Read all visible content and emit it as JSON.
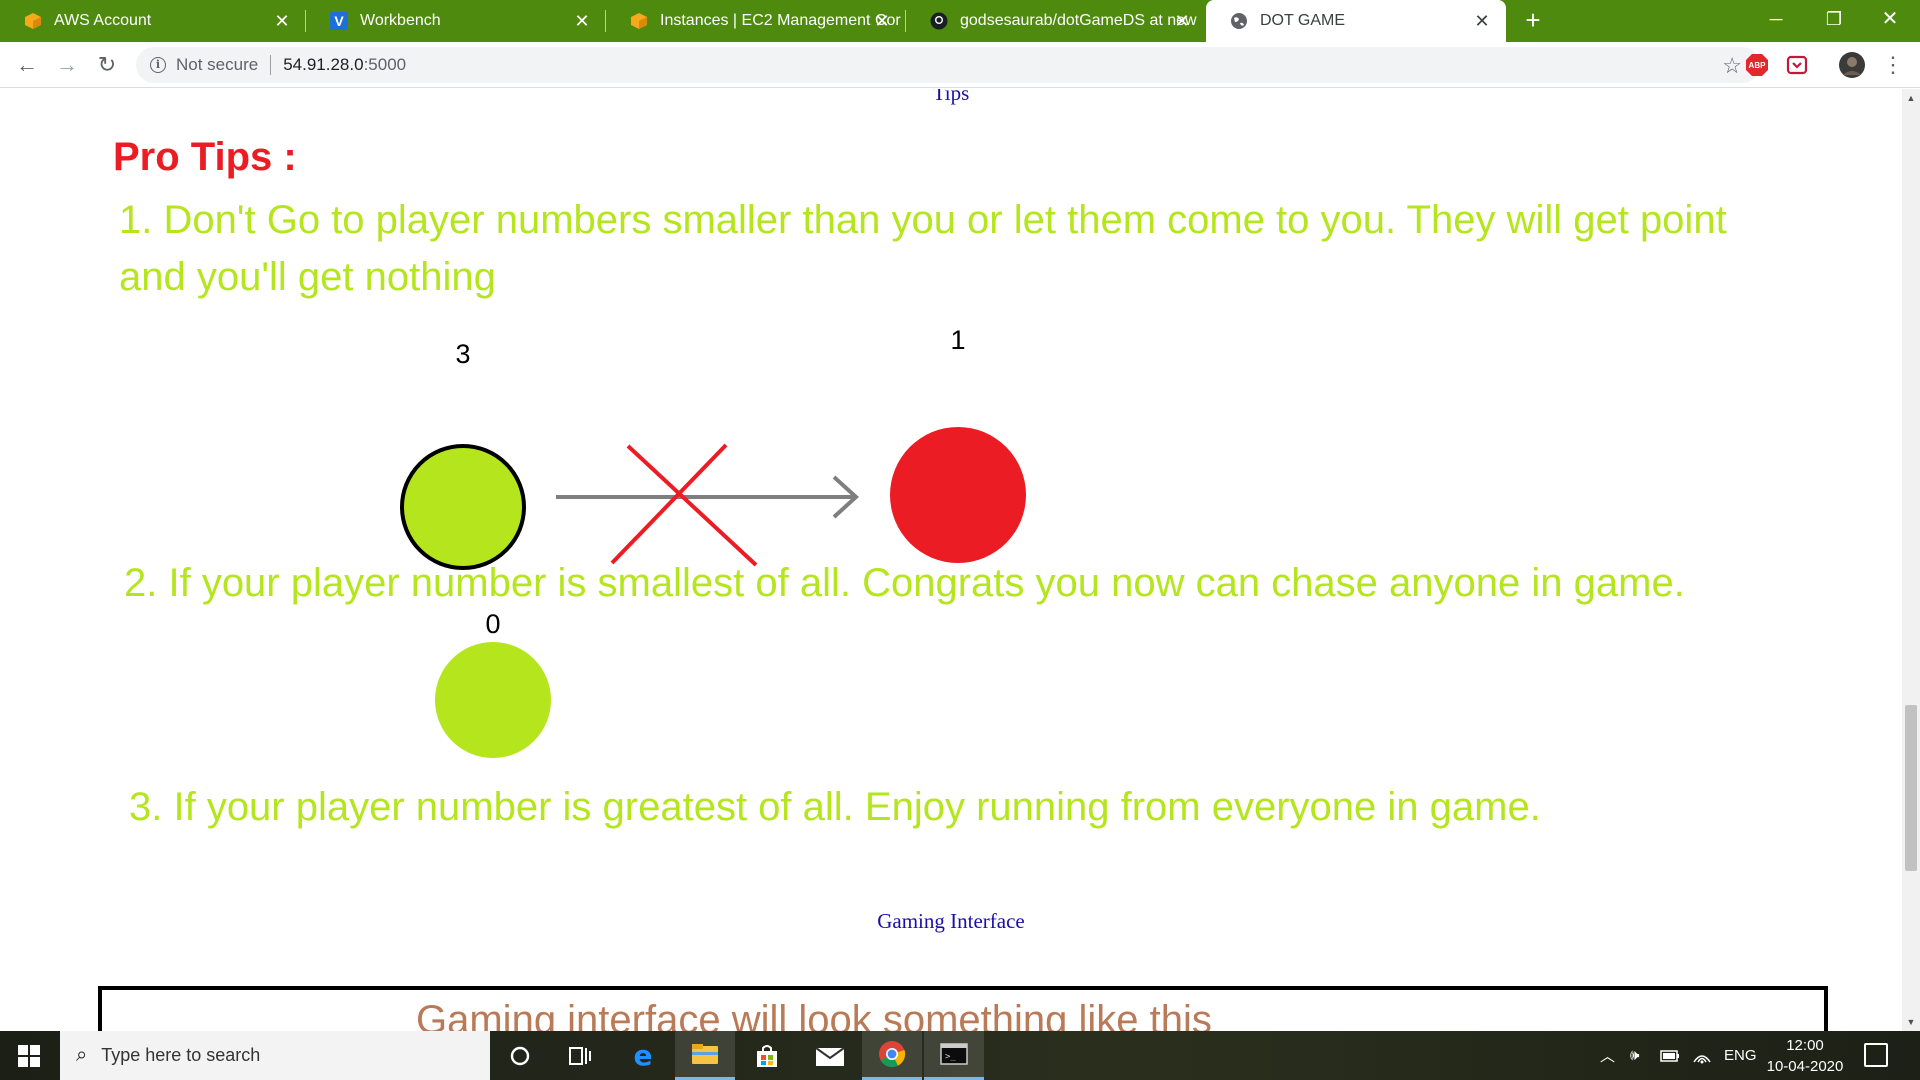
{
  "browser": {
    "tabs": [
      {
        "title": "AWS Account",
        "favicon": "aws-box-icon",
        "active": false
      },
      {
        "title": "Workbench",
        "favicon": "vocareum-v-icon",
        "active": false
      },
      {
        "title": "Instances | EC2 Management Cor",
        "favicon": "aws-box-icon",
        "active": false
      },
      {
        "title": "godsesaurab/dotGameDS at new",
        "favicon": "github-icon",
        "active": false
      },
      {
        "title": "DOT GAME",
        "favicon": "globe-icon",
        "active": true
      }
    ],
    "new_tab": "+",
    "address": {
      "security_label": "Not secure",
      "host": "54.91.28.0",
      "port": ":5000"
    },
    "extensions": [
      "adblock-plus-icon",
      "pocket-icon",
      "profile-avatar"
    ]
  },
  "page": {
    "tips_link": "Tips",
    "pro_tips_title": "Pro Tips :",
    "tip_1": "1. Don't Go to player numbers smaller than you or let them come to you. They will get point and you'll get nothing",
    "tip_2": "2. If your player number is smallest of all. Congrats you now can chase anyone in game.",
    "tip_3": "3. If your player number is greatest of all. Enjoy running from everyone in game.",
    "diagram_1": {
      "player_number": "3",
      "other_number": "1"
    },
    "diagram_2": {
      "player_number": "0"
    },
    "gaming_interface_link": "Gaming Interface",
    "interface_caption": "Gaming interface will look something like this"
  },
  "colors": {
    "tab_strip": "#4e8a0e",
    "tip_green": "#b5e61d",
    "tip_red": "#ec1c24",
    "link_blue": "#1a0dab",
    "caption_brown": "#b97a57"
  },
  "taskbar": {
    "search_placeholder": "Type here to search",
    "pinned": [
      "cortana-icon",
      "task-view-icon",
      "edge-icon",
      "file-explorer-icon",
      "store-icon",
      "mail-icon",
      "chrome-icon",
      "terminal-icon"
    ],
    "language": "ENG",
    "time": "12:00",
    "date": "10-04-2020"
  }
}
